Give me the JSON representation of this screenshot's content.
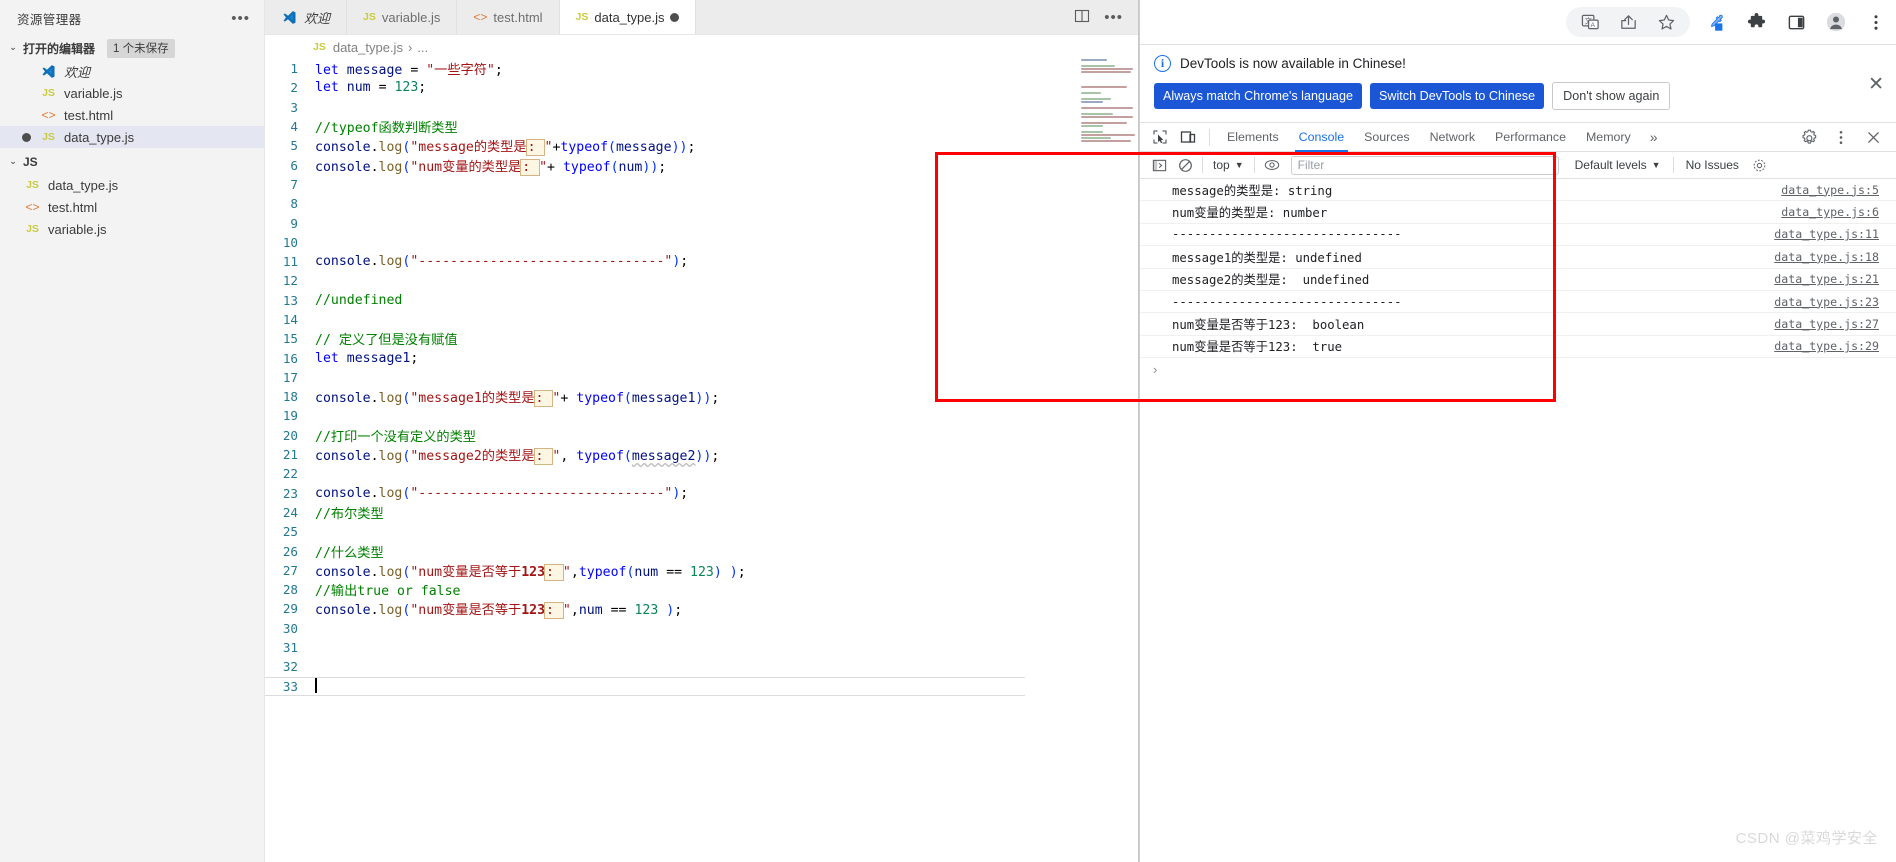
{
  "vscode": {
    "explorer": {
      "title": "资源管理器",
      "more_icon": "ellipsis-icon",
      "open_editors": {
        "label": "打开的编辑器",
        "badge": "1 个未保存",
        "items": [
          {
            "label": "欢迎",
            "icon": "vscode-logo-icon",
            "dirty": false,
            "italic": true
          },
          {
            "label": "variable.js",
            "icon": "js-icon",
            "dirty": false
          },
          {
            "label": "test.html",
            "icon": "html-icon",
            "dirty": false
          },
          {
            "label": "data_type.js",
            "icon": "js-icon",
            "dirty": true,
            "selected": true
          }
        ]
      },
      "folder": {
        "label": "JS",
        "items": [
          {
            "label": "data_type.js",
            "icon": "js-icon"
          },
          {
            "label": "test.html",
            "icon": "html-icon"
          },
          {
            "label": "variable.js",
            "icon": "js-icon"
          }
        ]
      }
    },
    "tabs": [
      {
        "label": "欢迎",
        "icon": "vscode-logo-icon",
        "active": false,
        "dirty": false
      },
      {
        "label": "variable.js",
        "icon": "js-icon",
        "active": false,
        "dirty": false
      },
      {
        "label": "test.html",
        "icon": "html-icon",
        "active": false,
        "dirty": false
      },
      {
        "label": "data_type.js",
        "icon": "js-icon",
        "active": true,
        "dirty": true
      }
    ],
    "tab_actions": [
      {
        "name": "split-editor-icon",
        "glyph": "▤"
      },
      {
        "name": "more-actions-icon",
        "glyph": "···"
      }
    ],
    "breadcrumb": {
      "file_icon": "js-icon",
      "file": "data_type.js",
      "separator": "›",
      "tail": "..."
    },
    "code_lines": [
      {
        "n": 1,
        "text": "let message = \"一些字符\";"
      },
      {
        "n": 2,
        "text": "let num = 123;"
      },
      {
        "n": 3,
        "text": ""
      },
      {
        "n": 4,
        "text": "//typeof函数判断类型"
      },
      {
        "n": 5,
        "text": "console.log(\"message的类型是: \"+typeof(message));"
      },
      {
        "n": 6,
        "text": "console.log(\"num变量的类型是: \"+ typeof(num));"
      },
      {
        "n": 7,
        "text": ""
      },
      {
        "n": 8,
        "text": ""
      },
      {
        "n": 9,
        "text": ""
      },
      {
        "n": 10,
        "text": ""
      },
      {
        "n": 11,
        "text": "console.log(\"-------------------------------\");"
      },
      {
        "n": 12,
        "text": ""
      },
      {
        "n": 13,
        "text": "//undefined"
      },
      {
        "n": 14,
        "text": ""
      },
      {
        "n": 15,
        "text": "// 定义了但是没有赋值"
      },
      {
        "n": 16,
        "text": "let message1;"
      },
      {
        "n": 17,
        "text": ""
      },
      {
        "n": 18,
        "text": "console.log(\"message1的类型是: \"+ typeof(message1));"
      },
      {
        "n": 19,
        "text": ""
      },
      {
        "n": 20,
        "text": "//打印一个没有定义的类型"
      },
      {
        "n": 21,
        "text": "console.log(\"message2的类型是: \", typeof(message2));"
      },
      {
        "n": 22,
        "text": ""
      },
      {
        "n": 23,
        "text": "console.log(\"-------------------------------\");"
      },
      {
        "n": 24,
        "text": "//布尔类型"
      },
      {
        "n": 25,
        "text": ""
      },
      {
        "n": 26,
        "text": "//什么类型"
      },
      {
        "n": 27,
        "text": "console.log(\"num变量是否等于123: \",typeof(num == 123) );"
      },
      {
        "n": 28,
        "text": "//输出true or false"
      },
      {
        "n": 29,
        "text": "console.log(\"num变量是否等于123: \",num == 123 );"
      },
      {
        "n": 30,
        "text": ""
      },
      {
        "n": 31,
        "text": ""
      },
      {
        "n": 32,
        "text": ""
      },
      {
        "n": 33,
        "text": ""
      }
    ]
  },
  "browser": {
    "toolbar_icons": [
      {
        "name": "translate-icon"
      },
      {
        "name": "share-icon"
      },
      {
        "name": "bookmark-star-icon"
      },
      {
        "name": "eyedropper-icon"
      },
      {
        "name": "extensions-puzzle-icon"
      },
      {
        "name": "side-panel-icon"
      },
      {
        "name": "profile-avatar-icon"
      },
      {
        "name": "chrome-menu-icon"
      }
    ]
  },
  "devtools": {
    "notice": {
      "icon": "info-icon",
      "text": "DevTools is now available in Chinese!",
      "buttons": [
        {
          "label": "Always match Chrome's language",
          "style": "primary"
        },
        {
          "label": "Switch DevTools to Chinese",
          "style": "primary"
        },
        {
          "label": "Don't show again",
          "style": "secondary"
        }
      ],
      "close_icon": "close-icon"
    },
    "panel_tabs": [
      {
        "label": "Elements",
        "active": false
      },
      {
        "label": "Console",
        "active": true
      },
      {
        "label": "Sources",
        "active": false
      },
      {
        "label": "Network",
        "active": false
      },
      {
        "label": "Performance",
        "active": false
      },
      {
        "label": "Memory",
        "active": false
      }
    ],
    "overflow_label": "»",
    "tools": [
      {
        "name": "inspect-element-icon"
      },
      {
        "name": "device-toolbar-icon"
      }
    ],
    "right_actions": [
      {
        "name": "settings-gear-icon"
      },
      {
        "name": "devtools-menu-icon"
      },
      {
        "name": "devtools-close-icon"
      }
    ],
    "console_toolbar": {
      "sidebar_icon": "console-sidebar-icon",
      "clear_icon": "clear-console-icon",
      "context": "top",
      "context_caret": "▼",
      "eye_icon": "live-expression-eye-icon",
      "filter_placeholder": "Filter",
      "levels": "Default levels",
      "levels_caret": "▼",
      "issues": "No Issues",
      "settings_icon": "console-settings-gear-icon"
    },
    "console_logs": [
      {
        "message": "message的类型是: string",
        "source": "data_type.js:5"
      },
      {
        "message": "num变量的类型是: number",
        "source": "data_type.js:6"
      },
      {
        "message": "-------------------------------",
        "source": "data_type.js:11"
      },
      {
        "message": "message1的类型是: undefined",
        "source": "data_type.js:18"
      },
      {
        "message": "message2的类型是:  undefined",
        "source": "data_type.js:21"
      },
      {
        "message": "-------------------------------",
        "source": "data_type.js:23"
      },
      {
        "message": "num变量是否等于123:  boolean",
        "source": "data_type.js:27"
      },
      {
        "message": "num变量是否等于123:  true",
        "source": "data_type.js:29"
      }
    ],
    "prompt_caret": "›"
  },
  "watermark": "CSDN @菜鸡学安全",
  "colors": {
    "accent_blue": "#1a73e8",
    "button_blue": "#1a56d6",
    "highlight_red": "#ff0000",
    "vscode_sidebar": "#f3f3f3",
    "selection": "#e4e6f1"
  }
}
